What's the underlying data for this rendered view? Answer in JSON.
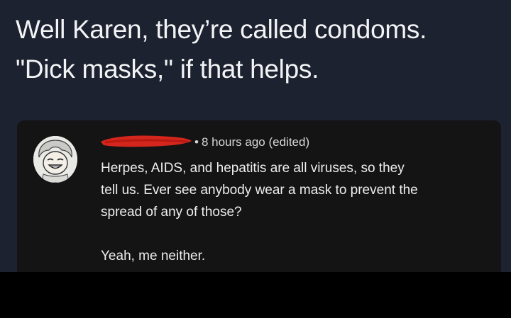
{
  "post": {
    "lines": [
      "Well Karen, they’re called condoms.",
      "\"Dick masks,\" if that helps."
    ]
  },
  "comment": {
    "author_redacted": true,
    "separator": "•",
    "timestamp": "8 hours ago (edited)",
    "body_lines": [
      "Herpes, AIDS, and hepatitis are all viruses, so they",
      "tell us. Ever see anybody wear a mask to prevent the",
      "spread of any of those?"
    ],
    "closing_line": "Yeah, me neither.",
    "avatar_icon": "avatar-face-icon",
    "redaction_color": "#d4261c"
  },
  "colors": {
    "post_background": "#1d2230",
    "card_background": "#141415"
  }
}
